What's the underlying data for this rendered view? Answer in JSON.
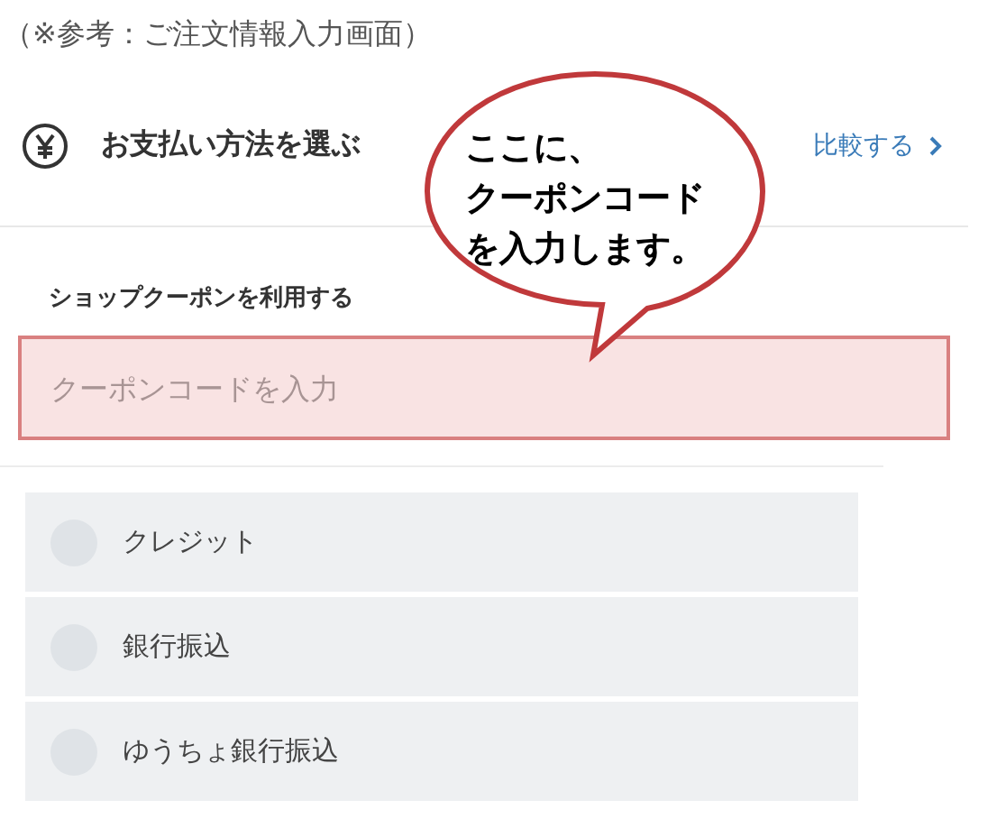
{
  "caption": "（※参考：ご注文情報入力画面）",
  "payment_header": {
    "title": "お支払い方法を選ぶ",
    "compare_link": "比較する"
  },
  "coupon": {
    "label": "ショップクーポンを利用する",
    "placeholder": "クーポンコードを入力",
    "highlighted": true
  },
  "callout": {
    "lines": [
      "ここに、",
      "クーポンコード",
      "を入力します。"
    ]
  },
  "payment_options": [
    {
      "label": "クレジット",
      "selected": false
    },
    {
      "label": "銀行振込",
      "selected": false
    },
    {
      "label": "ゆうちょ銀行振込",
      "selected": false
    }
  ]
}
